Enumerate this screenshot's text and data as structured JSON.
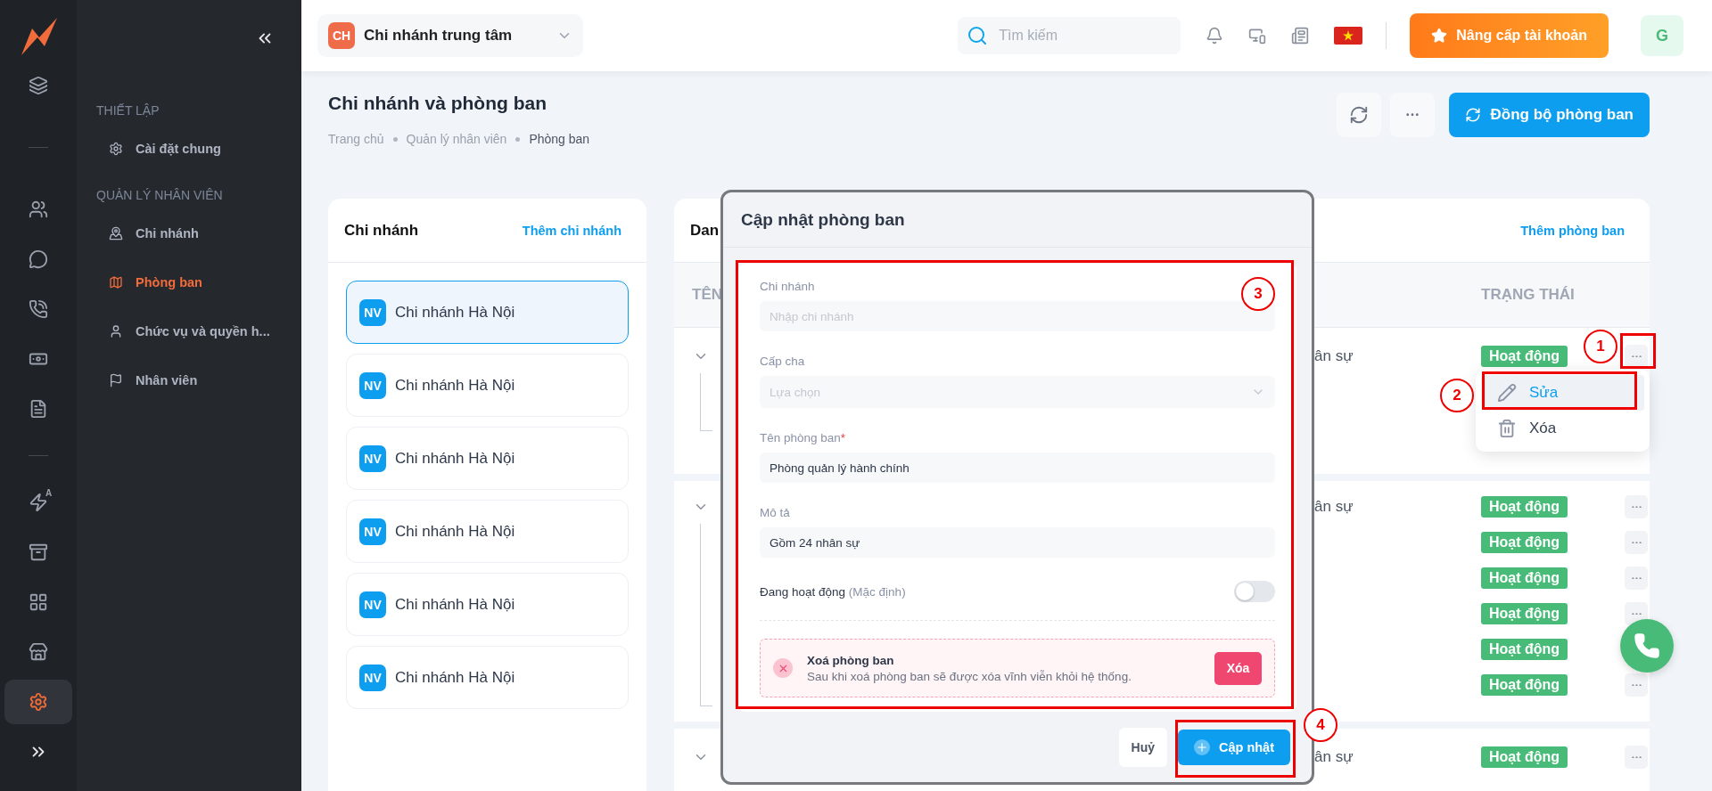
{
  "rail": [
    {
      "selected": false
    },
    {
      "selected": false
    },
    {
      "selected": false
    },
    {
      "selected": false
    },
    {
      "selected": false
    },
    {
      "selected": false
    },
    {
      "selected": false,
      "sup": "A"
    },
    {
      "selected": false
    },
    {
      "selected": false
    },
    {
      "selected": false
    },
    {
      "selected": true
    }
  ],
  "nav": {
    "groups": [
      {
        "title": "THIẾT LẬP",
        "items": [
          {
            "label": "Cài đặt chung",
            "selected": false
          }
        ]
      },
      {
        "title": "QUẢN LÝ NHÂN VIÊN",
        "items": [
          {
            "label": "Chi nhánh",
            "selected": false
          },
          {
            "label": "Phòng ban",
            "selected": true
          },
          {
            "label": "Chức vụ và quyền h...",
            "selected": false
          },
          {
            "label": "Nhân viên",
            "selected": false
          }
        ]
      }
    ]
  },
  "header": {
    "branch": {
      "badge": "CH",
      "name": "Chi nhánh trung tâm"
    },
    "search": {
      "placeholder": "Tìm kiếm"
    },
    "upgrade": "Nâng cấp tài khoản",
    "avatar": "G"
  },
  "page": {
    "title": "Chi nhánh và phòng ban",
    "breadcrumb": [
      "Trang chủ",
      "Quản lý nhân viên",
      "Phòng ban"
    ],
    "sync_button": "Đồng bộ phòng ban"
  },
  "branches": {
    "title": "Chi nhánh",
    "add_link": "Thêm chi nhánh",
    "items": [
      {
        "badge": "NV",
        "name": "Chi nhánh Hà Nội",
        "selected": true
      },
      {
        "badge": "NV",
        "name": "Chi nhánh Hà Nội",
        "selected": false
      },
      {
        "badge": "NV",
        "name": "Chi nhánh Hà Nội",
        "selected": false
      },
      {
        "badge": "NV",
        "name": "Chi nhánh Hà Nội",
        "selected": false
      },
      {
        "badge": "NV",
        "name": "Chi nhánh Hà Nội",
        "selected": false
      },
      {
        "badge": "NV",
        "name": "Chi nhánh Hà Nội",
        "selected": false
      }
    ]
  },
  "departments": {
    "title": "Dan",
    "add_link": "Thêm phòng ban",
    "columns": [
      "TÊN",
      "TRẠNG THÁI"
    ],
    "groups": [
      {
        "expanded": true,
        "rows": [
          {
            "note": "ân sự",
            "status": "Hoạt động"
          }
        ]
      },
      {
        "expanded": true,
        "rows": [
          {
            "note": "ân sự",
            "status": "Hoạt động"
          },
          {
            "status": "Hoạt động"
          },
          {
            "status": "Hoạt động"
          },
          {
            "status": "Hoạt động"
          },
          {
            "status": "Hoạt động"
          },
          {
            "status": "Hoạt động"
          }
        ]
      },
      {
        "expanded": true,
        "rows": [
          {
            "note": "ân sự",
            "status": "Hoạt động"
          }
        ]
      }
    ]
  },
  "row_menu": {
    "items": [
      {
        "label": "Sửa",
        "selected": true
      },
      {
        "label": "Xóa",
        "selected": false
      }
    ]
  },
  "modal": {
    "title": "Cập nhật phòng ban",
    "fields": [
      {
        "kind": "input",
        "label": "Chi nhánh",
        "placeholder": "Nhập chi nhánh"
      },
      {
        "kind": "select",
        "label": "Cấp cha",
        "placeholder": "Lựa chọn"
      },
      {
        "kind": "input",
        "label": "Tên phòng ban",
        "required_mark": "*",
        "value": "Phòng quản lý hành chính"
      },
      {
        "kind": "input",
        "label": "Mô tả",
        "value": "Gồm 24 nhân sự"
      }
    ],
    "toggle": {
      "label": "Đang hoạt động",
      "hint": "(Mặc định)",
      "on": false
    },
    "danger": {
      "title": "Xoá phòng ban",
      "text": "Sau khi xoá phòng ban sẽ được xóa vĩnh viễn khỏi hệ thống.",
      "button": "Xóa"
    },
    "cancel": "Huỷ",
    "submit": "Cập nhật"
  },
  "annotations": [
    "1",
    "2",
    "3",
    "4"
  ]
}
